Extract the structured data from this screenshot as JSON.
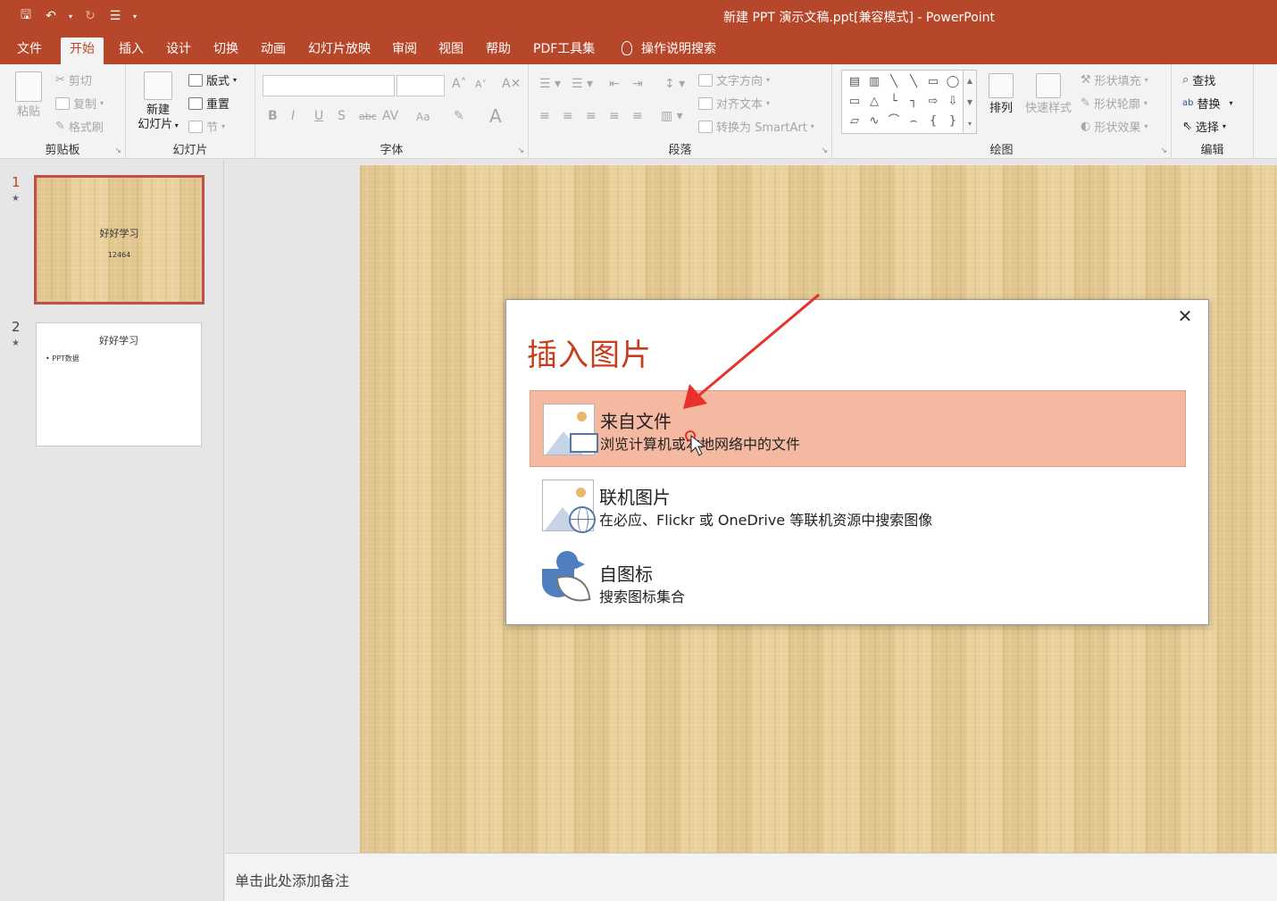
{
  "window": {
    "title": "新建 PPT 演示文稿.ppt[兼容模式]  -  PowerPoint"
  },
  "tabs": [
    {
      "label": "文件",
      "active": false
    },
    {
      "label": "开始",
      "active": true
    },
    {
      "label": "插入",
      "active": false
    },
    {
      "label": "设计",
      "active": false
    },
    {
      "label": "切换",
      "active": false
    },
    {
      "label": "动画",
      "active": false
    },
    {
      "label": "幻灯片放映",
      "active": false
    },
    {
      "label": "审阅",
      "active": false
    },
    {
      "label": "视图",
      "active": false
    },
    {
      "label": "帮助",
      "active": false
    },
    {
      "label": "PDF工具集",
      "active": false
    }
  ],
  "search_tab": {
    "label": "操作说明搜索"
  },
  "ribbon": {
    "clipboard": {
      "label": "剪贴板",
      "paste": "粘贴",
      "cut": "剪切",
      "copy": "复制",
      "format_painter": "格式刷"
    },
    "slides": {
      "label": "幻灯片",
      "new_slide_line1": "新建",
      "new_slide_line2": "幻灯片",
      "layout": "版式",
      "reset": "重置",
      "section": "节"
    },
    "font": {
      "label": "字体"
    },
    "paragraph": {
      "label": "段落",
      "text_direction": "文字方向",
      "align_text": "对齐文本",
      "smartart": "转换为 SmartArt"
    },
    "drawing": {
      "label": "绘图",
      "arrange": "排列",
      "quick_styles": "快速样式",
      "shape_fill": "形状填充",
      "shape_outline": "形状轮廓",
      "shape_effects": "形状效果"
    },
    "editing": {
      "label": "编辑",
      "find": "查找",
      "replace": "替换",
      "select": "选择"
    }
  },
  "thumbnails": [
    {
      "number": "1",
      "title": "好好学习",
      "subtitle": "12464",
      "selected": true
    },
    {
      "number": "2",
      "title": "好好学习",
      "bullet": "• PPT数据",
      "selected": false
    }
  ],
  "notes": {
    "placeholder": "单击此处添加备注"
  },
  "dialog": {
    "title": "插入图片",
    "options": [
      {
        "title": "来自文件",
        "desc": "浏览计算机或本地网络中的文件",
        "highlighted": true
      },
      {
        "title": "联机图片",
        "desc": "在必应、Flickr 或 OneDrive 等联机资源中搜索图像",
        "highlighted": false
      },
      {
        "title": "自图标",
        "desc": "搜索图标集合",
        "highlighted": false
      }
    ]
  },
  "colors": {
    "accent": "#b7472a",
    "highlight": "#f5b8a0",
    "dialog_title": "#c43e1c",
    "arrow": "#e8312a"
  },
  "icons": [
    "save-icon",
    "undo-icon",
    "redo-icon",
    "start-from-beginning-icon",
    "close-icon",
    "lightbulb-icon",
    "picture-icon",
    "monitor-icon",
    "globe-icon",
    "icon-set-icon"
  ]
}
